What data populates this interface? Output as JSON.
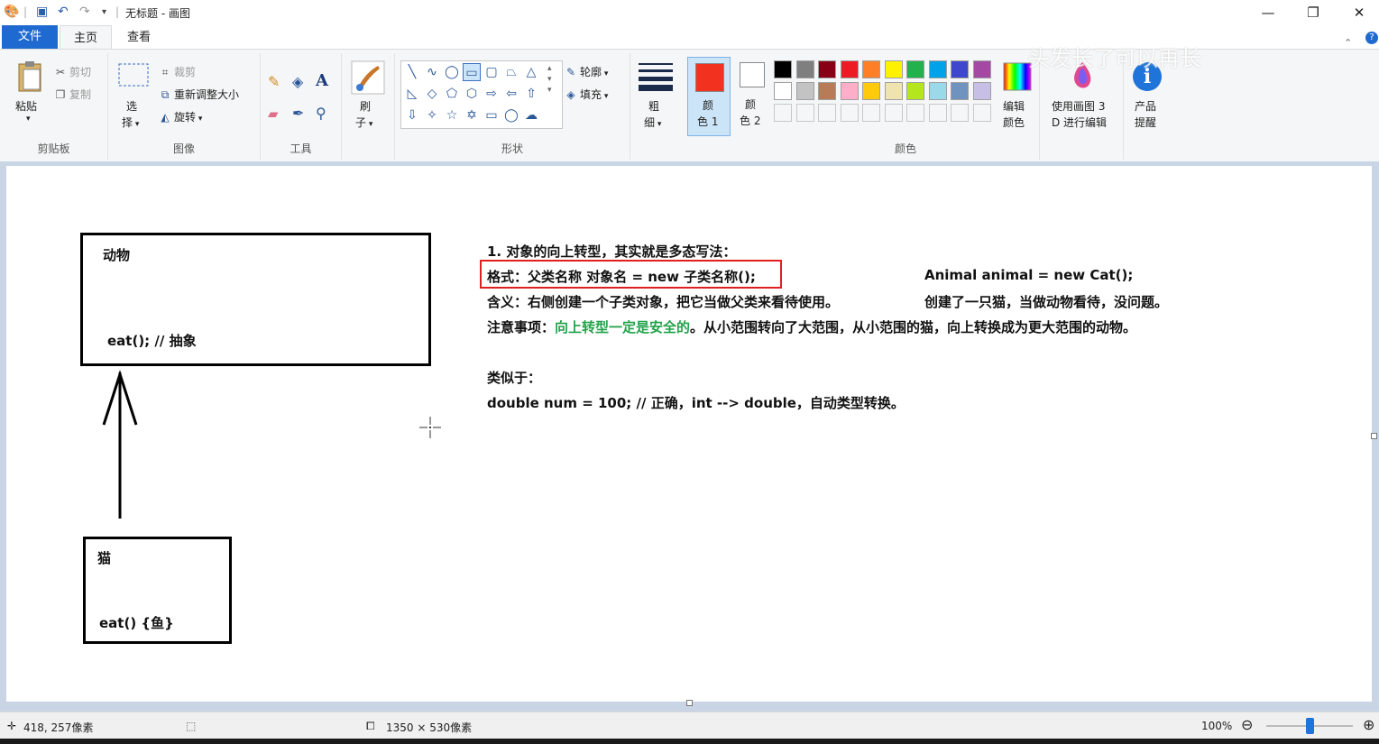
{
  "window": {
    "title": "无标题 - 画图",
    "minimize": "—",
    "restore": "❐",
    "close": "✕"
  },
  "tabs": {
    "file": "文件",
    "home": "主页",
    "view": "查看"
  },
  "help": "?",
  "ribbon": {
    "clipboard": {
      "label": "剪贴板",
      "paste": "粘贴",
      "cut": "剪切",
      "copy": "复制"
    },
    "image": {
      "label": "图像",
      "select_line1": "选",
      "select_line2": "择",
      "crop": "裁剪",
      "resize": "重新调整大小",
      "rotate": "旋转"
    },
    "tools": {
      "label": "工具"
    },
    "brush": {
      "line1": "刷",
      "line2": "子"
    },
    "shapes": {
      "label": "形状",
      "outline": "轮廓",
      "fill": "填充"
    },
    "size": {
      "line1": "粗",
      "line2": "细"
    },
    "color1": {
      "line1": "颜",
      "line2": "色 1",
      "color": "#f2311e"
    },
    "color2": {
      "line1": "颜",
      "line2": "色 2",
      "color": "#ffffff"
    },
    "colors": {
      "label": "颜色",
      "row1": [
        "#000000",
        "#7f7f7f",
        "#880015",
        "#ed1c24",
        "#ff7f27",
        "#fff200",
        "#22b14c",
        "#00a2e8",
        "#3f48cc",
        "#a349a4"
      ],
      "row2": [
        "#ffffff",
        "#c3c3c3",
        "#b97a57",
        "#ffaec9",
        "#ffc90e",
        "#efe4b0",
        "#b5e61d",
        "#99d9ea",
        "#7092be",
        "#c8bfe7"
      ]
    },
    "edit_colors": {
      "line1": "编辑",
      "line2": "颜色"
    },
    "paint3d": {
      "line1": "使用画图 3",
      "line2": "D 进行编辑"
    },
    "product": {
      "line1": "产品",
      "line2": "提醒"
    }
  },
  "watermark": "头发长了可以再长",
  "canvas": {
    "animal_box": {
      "title": "动物",
      "method": "eat(); // 抽象"
    },
    "cat_box": {
      "title": "猫",
      "method": "eat() {鱼}"
    },
    "lines": {
      "l1": "1. 对象的向上转型，其实就是多态写法：",
      "l2": "格式：父类名称 对象名 = new 子类名称();",
      "l2_right": "Animal animal = new Cat();",
      "l3": "含义：右侧创建一个子类对象，把它当做父类来看待使用。",
      "l3_right": "创建了一只猫，当做动物看待，没问题。",
      "l4_prefix": "注意事项：",
      "l4_green": "向上转型一定是安全的",
      "l4_rest": "。从小范围转向了大范围，从小范围的猫，向上转换成为更大范围的动物。",
      "l5": "类似于：",
      "l6": "double num = 100; // 正确，int --> double，自动类型转换。"
    },
    "highlight_color": "#e02020"
  },
  "status": {
    "cursor": "418, 257像素",
    "size": "1350 × 530像素",
    "zoom": "100%"
  }
}
